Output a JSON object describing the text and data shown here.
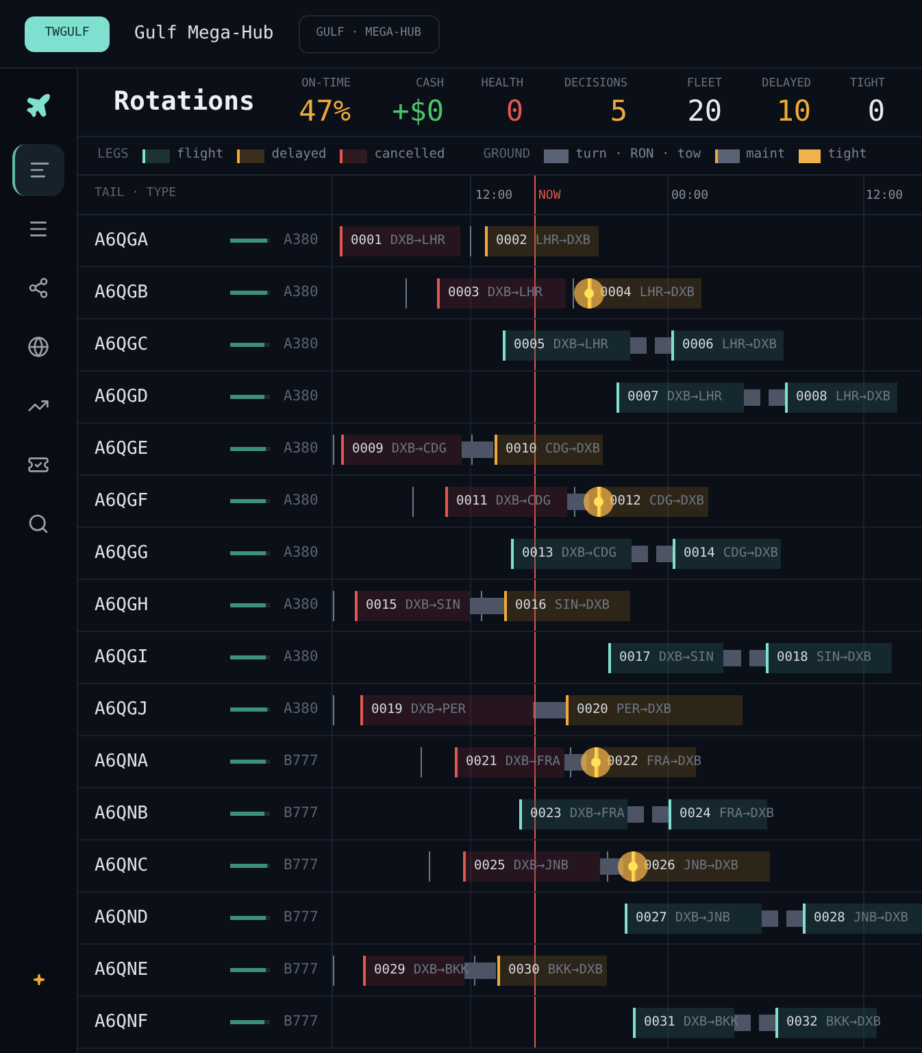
{
  "header": {
    "badge": "TWGULF",
    "title": "Gulf Mega-Hub",
    "tag": "GULF · MEGA-HUB"
  },
  "sidebar": {
    "items": [
      {
        "kind": "plane",
        "selected": false
      },
      {
        "kind": "rotations",
        "selected": true
      },
      {
        "kind": "list",
        "selected": false
      },
      {
        "kind": "network",
        "selected": false
      },
      {
        "kind": "globe",
        "selected": false
      },
      {
        "kind": "trend",
        "selected": false
      },
      {
        "kind": "ticket",
        "selected": false
      },
      {
        "kind": "search",
        "selected": false
      },
      {
        "kind": "sparkle",
        "selected": false
      }
    ]
  },
  "page_title": "Rotations",
  "stats": [
    {
      "label": "ON-TIME",
      "value": "47%",
      "color": "#f0a93a"
    },
    {
      "label": "CASH",
      "value": "+$0",
      "color": "#4cc36b"
    },
    {
      "label": "HEALTH",
      "value": "0",
      "color": "#e0584e"
    },
    {
      "label": "DECISIONS",
      "value": "5",
      "color": "#f0a93a"
    },
    {
      "label": "FLEET",
      "value": "20",
      "color": "#e8eaee"
    },
    {
      "label": "DELAYED",
      "value": "10",
      "color": "#f0a93a"
    },
    {
      "label": "TIGHT",
      "value": "0",
      "color": "#e8eaee"
    }
  ],
  "legend": [
    {
      "kind": "heading",
      "label": "LEGS"
    },
    {
      "kind": "flight",
      "label": "flight"
    },
    {
      "kind": "delayed",
      "label": "delayed"
    },
    {
      "kind": "cancelled",
      "label": "cancelled"
    },
    {
      "kind": "heading",
      "label": "GROUND"
    },
    {
      "kind": "turn",
      "label": "turn · RON · tow"
    },
    {
      "kind": "maint",
      "label": "maint"
    },
    {
      "kind": "tight",
      "label": "tight"
    }
  ],
  "columns": {
    "tail": "TAIL · TYPE",
    "ticks": [
      {
        "label": "12:00",
        "kind": "time"
      },
      {
        "label": "NOW",
        "kind": "now"
      },
      {
        "label": "00:00",
        "kind": "time"
      },
      {
        "label": "12:00",
        "kind": "time"
      }
    ]
  },
  "rows": [
    {
      "tail": "A6QGA",
      "type": "A380",
      "level": 0.92,
      "tight": false,
      "legs": [
        {
          "number": "0001",
          "route": "DXB→LHR",
          "kind": "cancelled"
        },
        {
          "number": "0002",
          "route": "LHR→DXB",
          "kind": "delayed"
        }
      ],
      "ground": []
    },
    {
      "tail": "A6QGB",
      "type": "A380",
      "level": 0.92,
      "tight": true,
      "legs": [
        {
          "number": "0003",
          "route": "DXB→LHR",
          "kind": "cancelled"
        },
        {
          "number": "0004",
          "route": "LHR→DXB",
          "kind": "delayed"
        }
      ],
      "ground": []
    },
    {
      "tail": "A6QGC",
      "type": "A380",
      "level": 0.86,
      "tight": false,
      "legs": [
        {
          "number": "0005",
          "route": "DXB→LHR",
          "kind": "flight"
        },
        {
          "number": "0006",
          "route": "LHR→DXB",
          "kind": "flight"
        }
      ],
      "ground": [
        {
          "kind": "turn"
        },
        {
          "kind": "turn"
        }
      ]
    },
    {
      "tail": "A6QGD",
      "type": "A380",
      "level": 0.86,
      "tight": false,
      "legs": [
        {
          "number": "0007",
          "route": "DXB→LHR",
          "kind": "flight"
        },
        {
          "number": "0008",
          "route": "LHR→DXB",
          "kind": "flight"
        }
      ],
      "ground": [
        {
          "kind": "turn"
        },
        {
          "kind": "turn"
        }
      ]
    },
    {
      "tail": "A6QGE",
      "type": "A380",
      "level": 0.88,
      "tight": false,
      "legs": [
        {
          "number": "0009",
          "route": "DXB→CDG",
          "kind": "cancelled"
        },
        {
          "number": "0010",
          "route": "CDG→DXB",
          "kind": "delayed"
        }
      ],
      "ground": [
        {
          "kind": "turn"
        }
      ]
    },
    {
      "tail": "A6QGF",
      "type": "A380",
      "level": 0.88,
      "tight": true,
      "legs": [
        {
          "number": "0011",
          "route": "DXB→CDG",
          "kind": "cancelled"
        },
        {
          "number": "0012",
          "route": "CDG→DXB",
          "kind": "delayed"
        }
      ],
      "ground": [
        {
          "kind": "turn"
        }
      ]
    },
    {
      "tail": "A6QGG",
      "type": "A380",
      "level": 0.88,
      "tight": false,
      "legs": [
        {
          "number": "0013",
          "route": "DXB→CDG",
          "kind": "flight"
        },
        {
          "number": "0014",
          "route": "CDG→DXB",
          "kind": "flight"
        }
      ],
      "ground": [
        {
          "kind": "turn"
        },
        {
          "kind": "turn"
        }
      ]
    },
    {
      "tail": "A6QGH",
      "type": "A380",
      "level": 0.88,
      "tight": false,
      "legs": [
        {
          "number": "0015",
          "route": "DXB→SIN",
          "kind": "cancelled"
        },
        {
          "number": "0016",
          "route": "SIN→DXB",
          "kind": "delayed"
        }
      ],
      "ground": [
        {
          "kind": "turn"
        }
      ]
    },
    {
      "tail": "A6QGI",
      "type": "A380",
      "level": 0.88,
      "tight": false,
      "legs": [
        {
          "number": "0017",
          "route": "DXB→SIN",
          "kind": "flight"
        },
        {
          "number": "0018",
          "route": "SIN→DXB",
          "kind": "flight"
        }
      ],
      "ground": [
        {
          "kind": "turn"
        },
        {
          "kind": "turn"
        }
      ]
    },
    {
      "tail": "A6QGJ",
      "type": "A380",
      "level": 0.92,
      "tight": false,
      "legs": [
        {
          "number": "0019",
          "route": "DXB→PER",
          "kind": "cancelled"
        },
        {
          "number": "0020",
          "route": "PER→DXB",
          "kind": "delayed"
        }
      ],
      "ground": [
        {
          "kind": "turn"
        }
      ]
    },
    {
      "tail": "A6QNA",
      "type": "B777",
      "level": 0.88,
      "tight": true,
      "legs": [
        {
          "number": "0021",
          "route": "DXB→FRA",
          "kind": "cancelled"
        },
        {
          "number": "0022",
          "route": "FRA→DXB",
          "kind": "delayed"
        }
      ],
      "ground": [
        {
          "kind": "turn"
        }
      ]
    },
    {
      "tail": "A6QNB",
      "type": "B777",
      "level": 0.86,
      "tight": false,
      "legs": [
        {
          "number": "0023",
          "route": "DXB→FRA",
          "kind": "flight"
        },
        {
          "number": "0024",
          "route": "FRA→DXB",
          "kind": "flight"
        }
      ],
      "ground": [
        {
          "kind": "turn"
        },
        {
          "kind": "turn"
        }
      ]
    },
    {
      "tail": "A6QNC",
      "type": "B777",
      "level": 0.92,
      "tight": true,
      "legs": [
        {
          "number": "0025",
          "route": "DXB→JNB",
          "kind": "cancelled"
        },
        {
          "number": "0026",
          "route": "JNB→DXB",
          "kind": "delayed"
        }
      ],
      "ground": [
        {
          "kind": "turn"
        }
      ]
    },
    {
      "tail": "A6QND",
      "type": "B777",
      "level": 0.88,
      "tight": false,
      "legs": [
        {
          "number": "0027",
          "route": "DXB→JNB",
          "kind": "flight"
        },
        {
          "number": "0028",
          "route": "JNB→DXB",
          "kind": "flight"
        }
      ],
      "ground": [
        {
          "kind": "turn"
        },
        {
          "kind": "turn"
        }
      ]
    },
    {
      "tail": "A6QNE",
      "type": "B777",
      "level": 0.88,
      "tight": false,
      "legs": [
        {
          "number": "0029",
          "route": "DXB→BKK",
          "kind": "cancelled"
        },
        {
          "number": "0030",
          "route": "BKK→DXB",
          "kind": "delayed"
        }
      ],
      "ground": [
        {
          "kind": "turn"
        }
      ]
    },
    {
      "tail": "A6QNF",
      "type": "B777",
      "level": 0.86,
      "tight": false,
      "legs": [
        {
          "number": "0031",
          "route": "DXB→BKK",
          "kind": "flight"
        },
        {
          "number": "0032",
          "route": "BKK→DXB",
          "kind": "flight"
        }
      ],
      "ground": [
        {
          "kind": "turn"
        },
        {
          "kind": "turn"
        }
      ]
    }
  ]
}
